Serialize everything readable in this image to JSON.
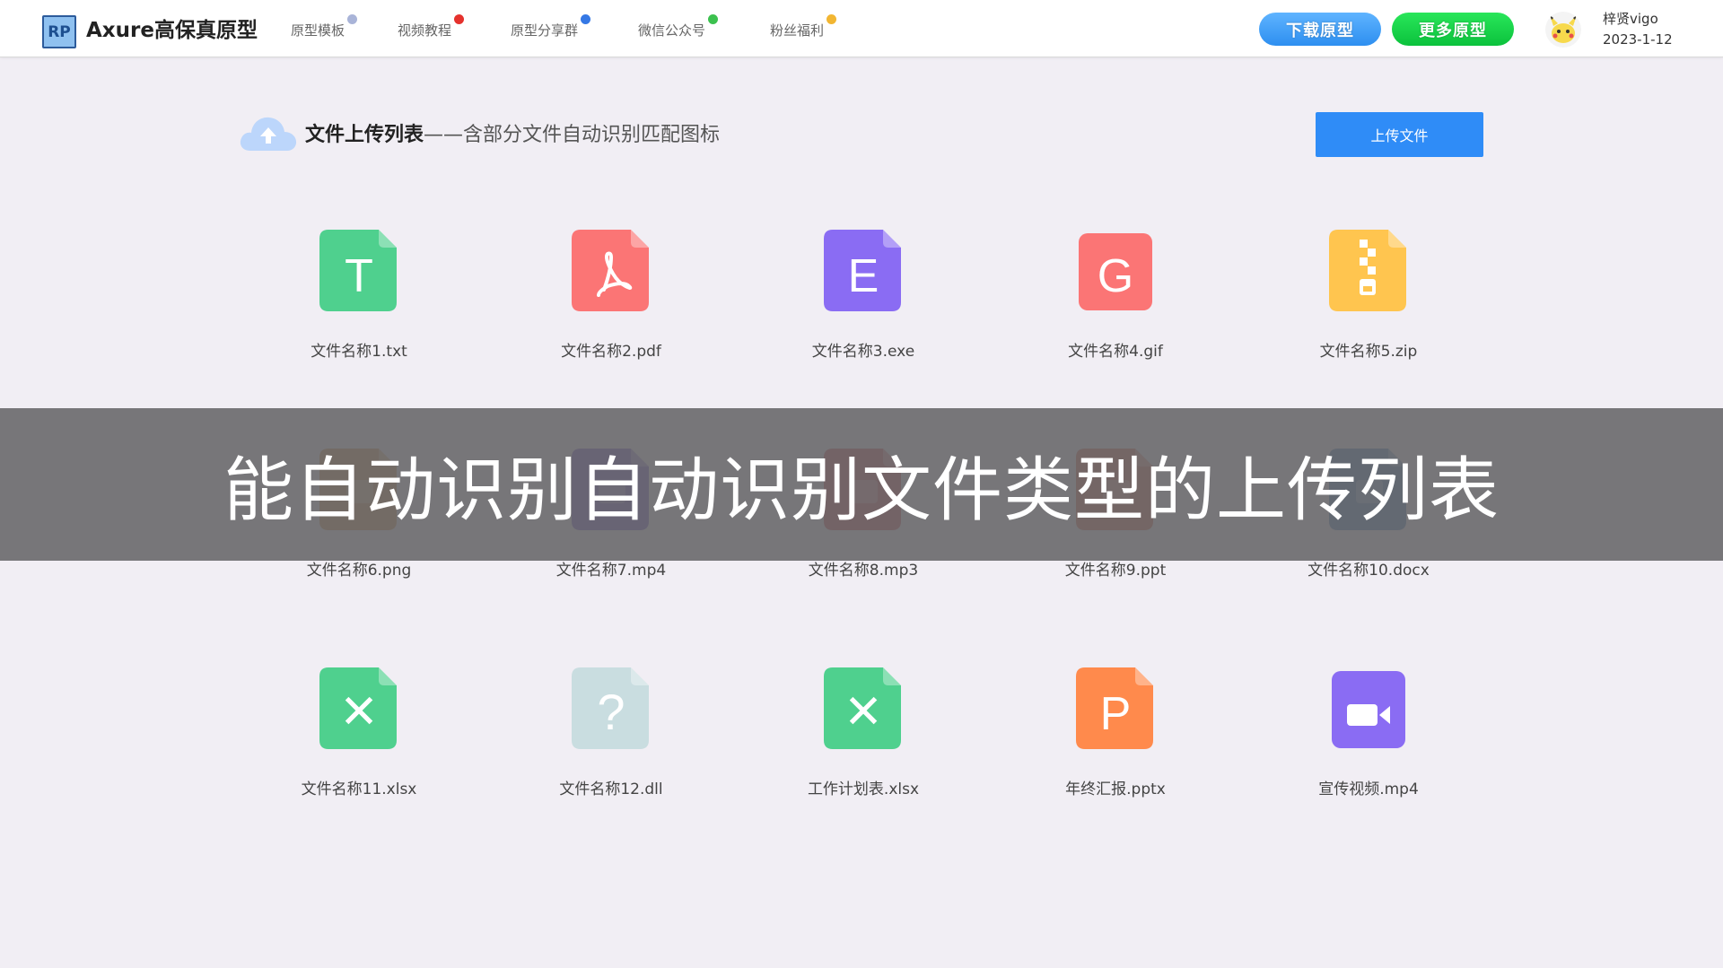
{
  "header": {
    "logo_text": "RP",
    "brand": "Axure高保真原型",
    "nav": [
      {
        "label": "原型模板",
        "icon": "badge-icon"
      },
      {
        "label": "视频教程",
        "icon": "apple-icon"
      },
      {
        "label": "原型分享群",
        "icon": "verified-icon"
      },
      {
        "label": "微信公众号",
        "icon": "wechat-icon"
      },
      {
        "label": "粉丝福利",
        "icon": "gift-icon"
      }
    ],
    "download_label": "下载原型",
    "more_label": "更多原型",
    "user_name": "梓贤vigo",
    "date": "2023-1-12"
  },
  "section": {
    "title": "文件上传列表",
    "subtitle": "——含部分文件自动识别匹配图标",
    "upload_label": "上传文件"
  },
  "files": [
    {
      "name": "文件名称1.txt",
      "icon": "txt-file-icon",
      "glyph": "T",
      "color": "#4fd08e"
    },
    {
      "name": "文件名称2.pdf",
      "icon": "pdf-file-icon",
      "glyph": "",
      "color": "#fb7575"
    },
    {
      "name": "文件名称3.exe",
      "icon": "exe-file-icon",
      "glyph": "E",
      "color": "#8a6cf3"
    },
    {
      "name": "文件名称4.gif",
      "icon": "gif-file-icon",
      "glyph": "G",
      "color": "#fb7575"
    },
    {
      "name": "文件名称5.zip",
      "icon": "zip-file-icon",
      "glyph": "",
      "color": "#ffc54f"
    },
    {
      "name": "文件名称6.png",
      "icon": "png-file-icon",
      "glyph": "",
      "color": "#c9892a"
    },
    {
      "name": "文件名称7.mp4",
      "icon": "mp4-file-icon",
      "glyph": "",
      "color": "#5b3fc2"
    },
    {
      "name": "文件名称8.mp3",
      "icon": "mp3-file-icon",
      "glyph": "",
      "color": "#c83b3b"
    },
    {
      "name": "文件名称9.ppt",
      "icon": "ppt-file-icon",
      "glyph": "",
      "color": "#d4512a"
    },
    {
      "name": "文件名称10.docx",
      "icon": "docx-file-icon",
      "glyph": "",
      "color": "#2c6fae"
    },
    {
      "name": "文件名称11.xlsx",
      "icon": "xlsx-file-icon",
      "glyph": "X",
      "color": "#4fd08e"
    },
    {
      "name": "文件名称12.dll",
      "icon": "unknown-file-icon",
      "glyph": "?",
      "color": "#c9dde0"
    },
    {
      "name": "工作计划表.xlsx",
      "icon": "xlsx-file-icon",
      "glyph": "X",
      "color": "#4fd08e"
    },
    {
      "name": "年终汇报.pptx",
      "icon": "pptx-file-icon",
      "glyph": "P",
      "color": "#ff8a4c"
    },
    {
      "name": "宣传视频.mp4",
      "icon": "video-file-icon",
      "glyph": "",
      "color": "#8a6cf3"
    }
  ],
  "banner": {
    "text": "能自动识别自动识别文件类型的上传列表"
  }
}
